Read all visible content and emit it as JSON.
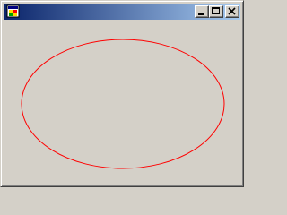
{
  "window": {
    "title": "",
    "title_gradient_from": "#0a246a",
    "title_gradient_to": "#a6caf0",
    "icon": "application-icon",
    "buttons": {
      "minimize_icon": "minimize-icon",
      "maximize_icon": "maximize-icon",
      "close_icon": "close-icon"
    }
  },
  "canvas": {
    "background": "#d4d0c8",
    "shape": "ellipse",
    "stroke_color": "#ff0000"
  }
}
